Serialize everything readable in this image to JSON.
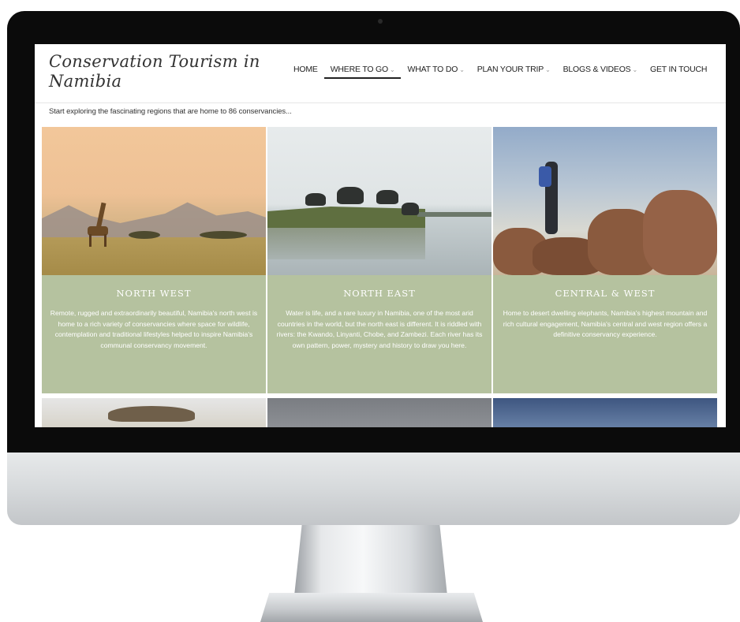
{
  "site": {
    "logo": "Conservation Tourism in Namibia",
    "tagline": "Start exploring the fascinating regions that are home to 86 conservancies..."
  },
  "nav": [
    {
      "label": "HOME",
      "active": false,
      "dropdown": false
    },
    {
      "label": "WHERE TO GO",
      "active": true,
      "dropdown": true
    },
    {
      "label": "WHAT TO DO",
      "active": false,
      "dropdown": true
    },
    {
      "label": "PLAN YOUR TRIP",
      "active": false,
      "dropdown": true
    },
    {
      "label": "BLOGS & VIDEOS",
      "active": false,
      "dropdown": true
    },
    {
      "label": "GET IN TOUCH",
      "active": false,
      "dropdown": false
    }
  ],
  "regions": [
    {
      "title": "NORTH WEST",
      "text": "Remote, rugged and extraordinarily beautiful, Namibia's north west is home to a rich variety of conservancies where space for wildlife, contemplation and traditional lifestyles helped to inspire Namibia's communal conservancy movement."
    },
    {
      "title": "NORTH EAST",
      "text": "Water is life, and a rare luxury in Namibia, one of the most arid countries in the world, but the north east is different. It is riddled with rivers: the Kwando, Linyanti, Chobe, and Zambezi. Each river has its own pattern, power, mystery and history to draw you here."
    },
    {
      "title": "CENTRAL & WEST",
      "text": "Home to desert dwelling elephants, Namibia's highest mountain and rich cultural engagement, Namibia's central and west region offers a definitive conservancy experience."
    }
  ],
  "colors": {
    "card_background": "#b5c29f",
    "bezel": "#0b0b0b"
  },
  "icons": {
    "dropdown": "chevron-down-icon"
  }
}
